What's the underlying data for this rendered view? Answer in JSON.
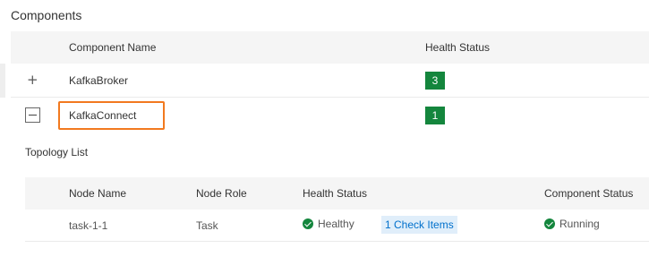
{
  "section": {
    "title": "Components"
  },
  "components_table": {
    "columns": {
      "name": "Component Name",
      "health": "Health Status"
    },
    "rows": [
      {
        "toggle": "+",
        "toggle_icon": "expand-plus-icon",
        "name": "KafkaBroker",
        "health_count": "3",
        "expanded": false
      },
      {
        "toggle": "−",
        "toggle_icon": "collapse-minus-icon",
        "name": "KafkaConnect",
        "health_count": "1",
        "expanded": true,
        "highlighted": true
      }
    ]
  },
  "topology": {
    "title": "Topology List",
    "columns": {
      "node_name": "Node Name",
      "node_role": "Node Role",
      "health_status": "Health Status",
      "component_status": "Component Status"
    },
    "rows": [
      {
        "node_name": "task-1-1",
        "node_role": "Task",
        "health_status": "Healthy",
        "check_items": "1 Check Items",
        "component_status": "Running"
      }
    ]
  },
  "colors": {
    "healthy_green": "#14863d",
    "highlight_orange": "#f2791f",
    "link_blue": "#0070cc",
    "tag_bg": "#e0eefa",
    "header_bg": "#f5f5f5"
  }
}
